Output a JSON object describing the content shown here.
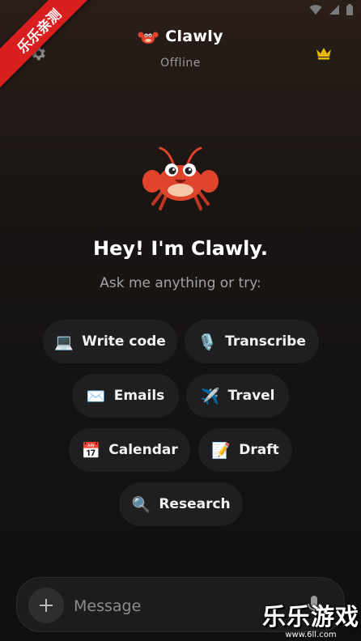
{
  "watermark": {
    "ribbon": "乐乐亲测",
    "brand": "乐乐游戏",
    "url": "www.6ll.com"
  },
  "header": {
    "icon": "crab-icon",
    "title": "Clawly",
    "status": "Offline"
  },
  "welcome": {
    "greeting": "Hey! I'm Clawly.",
    "prompt": "Ask me anything or try:"
  },
  "suggestions": [
    {
      "emoji": "💻",
      "label": "Write code"
    },
    {
      "emoji": "🎙️",
      "label": "Transcribe"
    },
    {
      "emoji": "✉️",
      "label": "Emails"
    },
    {
      "emoji": "✈️",
      "label": "Travel"
    },
    {
      "emoji": "📅",
      "label": "Calendar"
    },
    {
      "emoji": "📝",
      "label": "Draft"
    },
    {
      "emoji": "🔍",
      "label": "Research"
    }
  ],
  "composer": {
    "placeholder": "Message"
  },
  "colors": {
    "accent": "#e4b800",
    "chip_bg": "#1f1f21",
    "crab": "#e0442a",
    "ribbon": "#d81e1e"
  }
}
